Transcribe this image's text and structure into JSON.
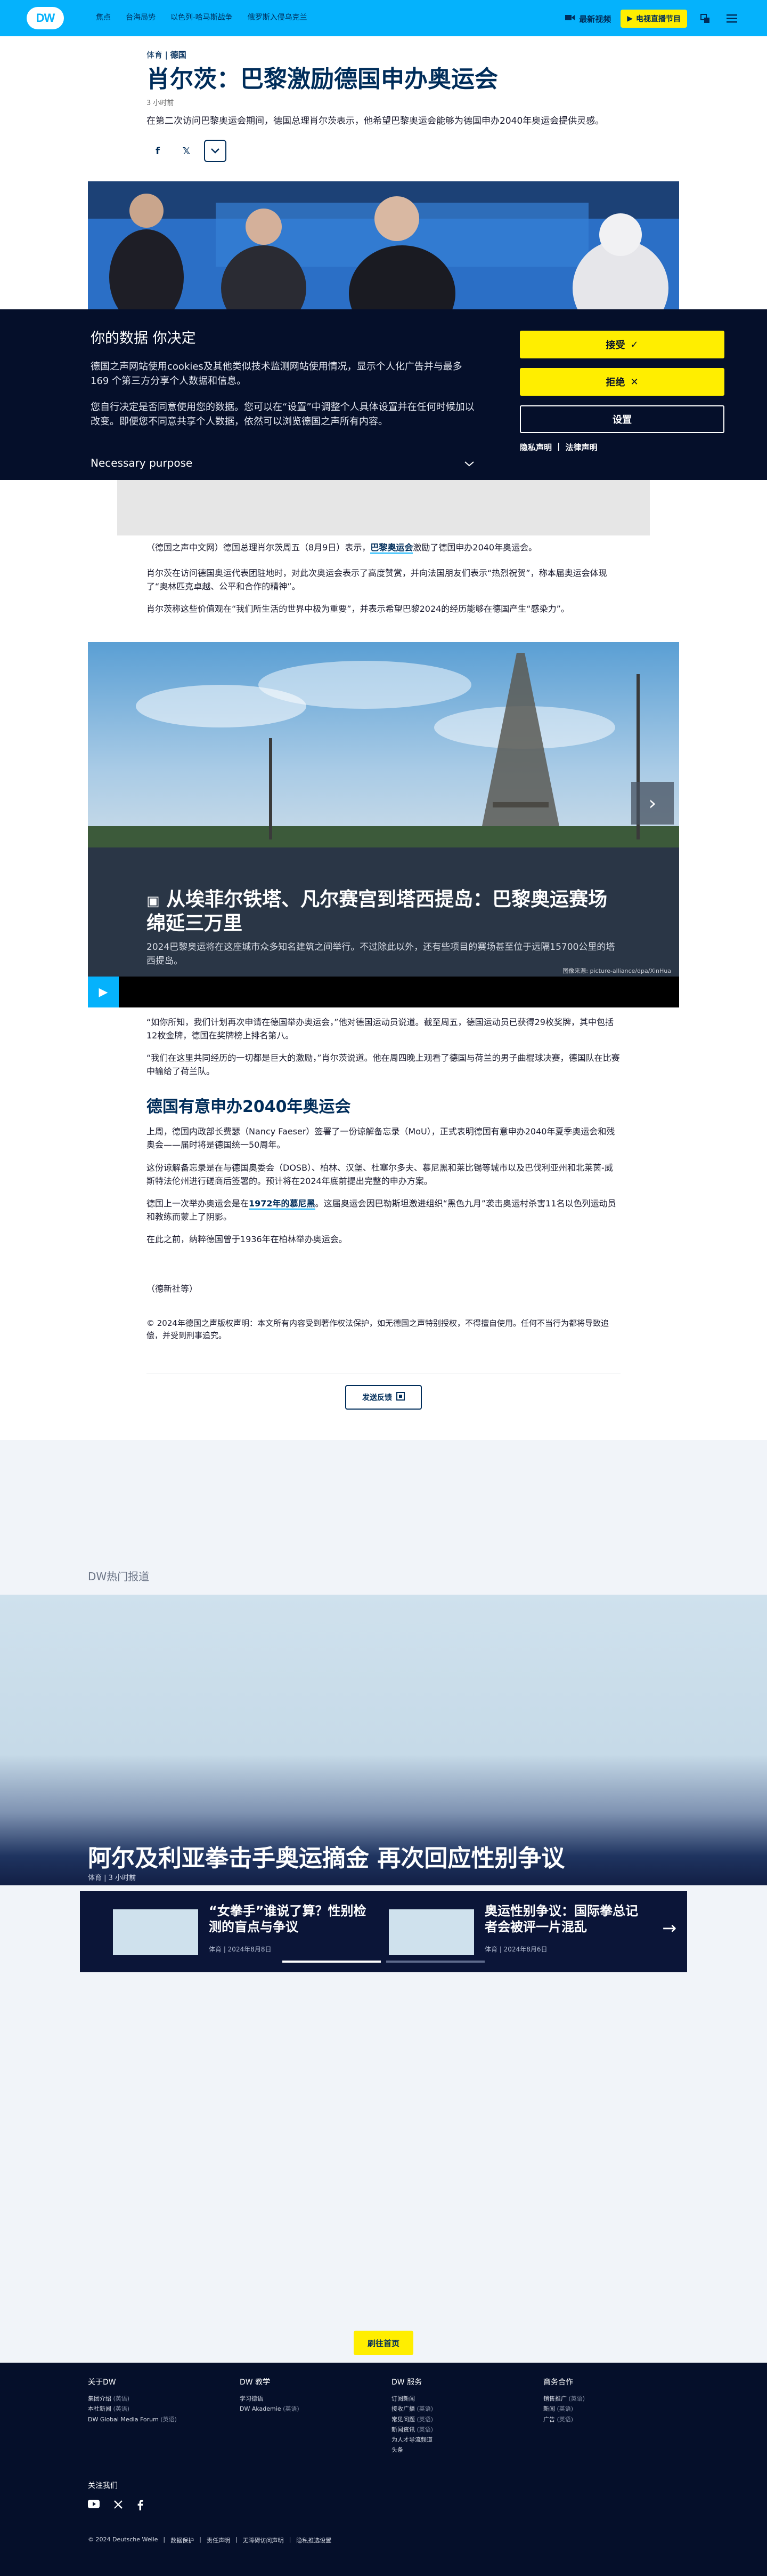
{
  "nav": {
    "logo": "DW",
    "links": [
      "焦点",
      "台海局势",
      "以色列-哈马斯战争",
      "俄罗斯入侵乌克兰"
    ],
    "tv": "最新视频",
    "live": "电视直播节目"
  },
  "article": {
    "kicker_section": "体育",
    "kicker_region": "德国",
    "title": "肖尔茨：巴黎激励德国申办奥运会",
    "time": "3 小时前",
    "teaser": "在第二次访问巴黎奥运会期间，德国总理肖尔茨表示，他希望巴黎奥运会能够为德国申办2040年奥运会提供灵感。",
    "share": [
      "f",
      "𝕏"
    ]
  },
  "cookie": {
    "title": "你的数据 你决定",
    "p1": "德国之声网站使用cookies及其他类似技术监测网站使用情况，显示个人化广告并与最多169 个第三方分享个人数据和信息。",
    "p2": "您自行决定是否同意使用您的数据。您可以在“设置”中调整个人具体设置并在任何时候加以改变。即便您不同意共享个人数据，依然可以浏览德国之声所有内容。",
    "purpose": "Necessary purpose",
    "accept": "接受",
    "reject": "拒绝",
    "settings": "设置",
    "privacy": "隐私声明",
    "legal": "法律声明"
  },
  "body": {
    "p1_pre": "（德国之声中文网）德国总理肖尔茨周五（8月9日）表示，",
    "p1_link": "巴黎奥运会",
    "p1_post": "激励了德国申办2040年奥运会。",
    "p2": "肖尔茨在访问德国奥运代表团驻地时，对此次奥运会表示了高度赞赏，并向法国朋友们表示“热烈祝贺”，称本届奥运会体现了“奥林匹克卓越、公平和合作的精神”。",
    "p3": "肖尔茨称这些价值观在“我们所生活的世界中极为重要”，并表示希望巴黎2024的经历能够在德国产生“感染力”。",
    "p4": "“如你所知，我们计划再次申请在德国举办奥运会，”他对德国运动员说道。截至周五，德国运动员已获得29枚奖牌，其中包括12枚金牌，德国在奖牌榜上排名第八。",
    "p5": "“我们在这里共同经历的一切都是巨大的激励，”肖尔茨说道。他在周四晚上观看了德国与荷兰的男子曲棍球决赛，德国队在比赛中输给了荷兰队。",
    "h2": "德国有意申办2040年奥运会",
    "p6": "上周，德国内政部长费瑟（Nancy Faeser）签署了一份谅解备忘录（MoU），正式表明德国有意申办2040年夏季奥运会和残奥会——届时将是德国统一50周年。",
    "p7": "这份谅解备忘录是在与德国奥委会（DOSB）、柏林、汉堡、杜塞尔多夫、慕尼黑和莱比锡等城市以及巴伐利亚州和北莱茵-威斯特法伦州进行磋商后签署的。预计将在2024年底前提出完整的申办方案。",
    "p8_pre": "德国上一次举办奥运会是在",
    "p8_link": "1972年的慕尼黑",
    "p8_post": "。这届奥运会因巴勒斯坦激进组织“黑色九月”袭击奥运村杀害11名以色列运动员和教练而蒙上了阴影。",
    "p9": "在此之前，纳粹德国曾于1936年在柏林举办奥运会。",
    "source": "（德新社等）",
    "copyright": "© 2024年德国之声版权声明：本文所有内容受到著作权法保护，如无德国之声特别授权，不得擅自使用。任何不当行为都将导致追偿，并受到刑事追究。",
    "feedback": "发送反馈"
  },
  "gallery": {
    "title": "从埃菲尔铁塔、凡尔赛宫到塔西提岛：巴黎奥运赛场绵延三万里",
    "desc": "2024巴黎奥运将在这座城市众多知名建筑之间举行。不过除此以外，还有些项目的赛场甚至位于远隔15700公里的塔西提岛。",
    "credit": "图像来源: picture-alliance/dpa/XinHua"
  },
  "hot": {
    "label": "DW热门报道",
    "title": "阿尔及利亚拳击手奥运摘金 再次回应性别争议",
    "meta_cat": "体育",
    "meta_time": "3 小时前",
    "cards": [
      {
        "title": "“女拳手”谁说了算？性别检测的盲点与争议",
        "meta": "体育 | 2024年8月8日"
      },
      {
        "title": "奥运性别争议：国际拳总记者会被评一片混乱",
        "meta": "体育 | 2024年8月6日"
      }
    ],
    "more": "刷往首页"
  },
  "footer": {
    "cols": [
      {
        "head": "关于DW",
        "items": [
          [
            "集团介绍",
            "(英语)"
          ],
          [
            "本社新闻",
            "(英语)"
          ],
          [
            "DW Global Media Forum",
            "(英语)"
          ]
        ]
      },
      {
        "head": "DW 教学",
        "items": [
          [
            "学习德语",
            ""
          ],
          [
            "DW Akademie",
            "(英语)"
          ]
        ]
      },
      {
        "head": "DW 服务",
        "items": [
          [
            "订阅新闻",
            ""
          ],
          [
            "接收广播",
            "(英语)"
          ],
          [
            "常见问题",
            "(英语)"
          ],
          [
            "新闻资讯",
            "(英语)"
          ],
          [
            "为人才导流频道",
            ""
          ],
          [
            "头条",
            ""
          ]
        ]
      },
      {
        "head": "商务合作",
        "items": [
          [
            "销售推广",
            "(英语)"
          ],
          [
            "新闻",
            "(英语)"
          ],
          [
            "广告",
            "(英语)"
          ]
        ]
      }
    ],
    "follow": "关注我们",
    "legal": [
      "© 2024 Deutsche Welle",
      "数据保护",
      "责任声明",
      "无障碍访问声明",
      "隐私推选设置"
    ]
  }
}
